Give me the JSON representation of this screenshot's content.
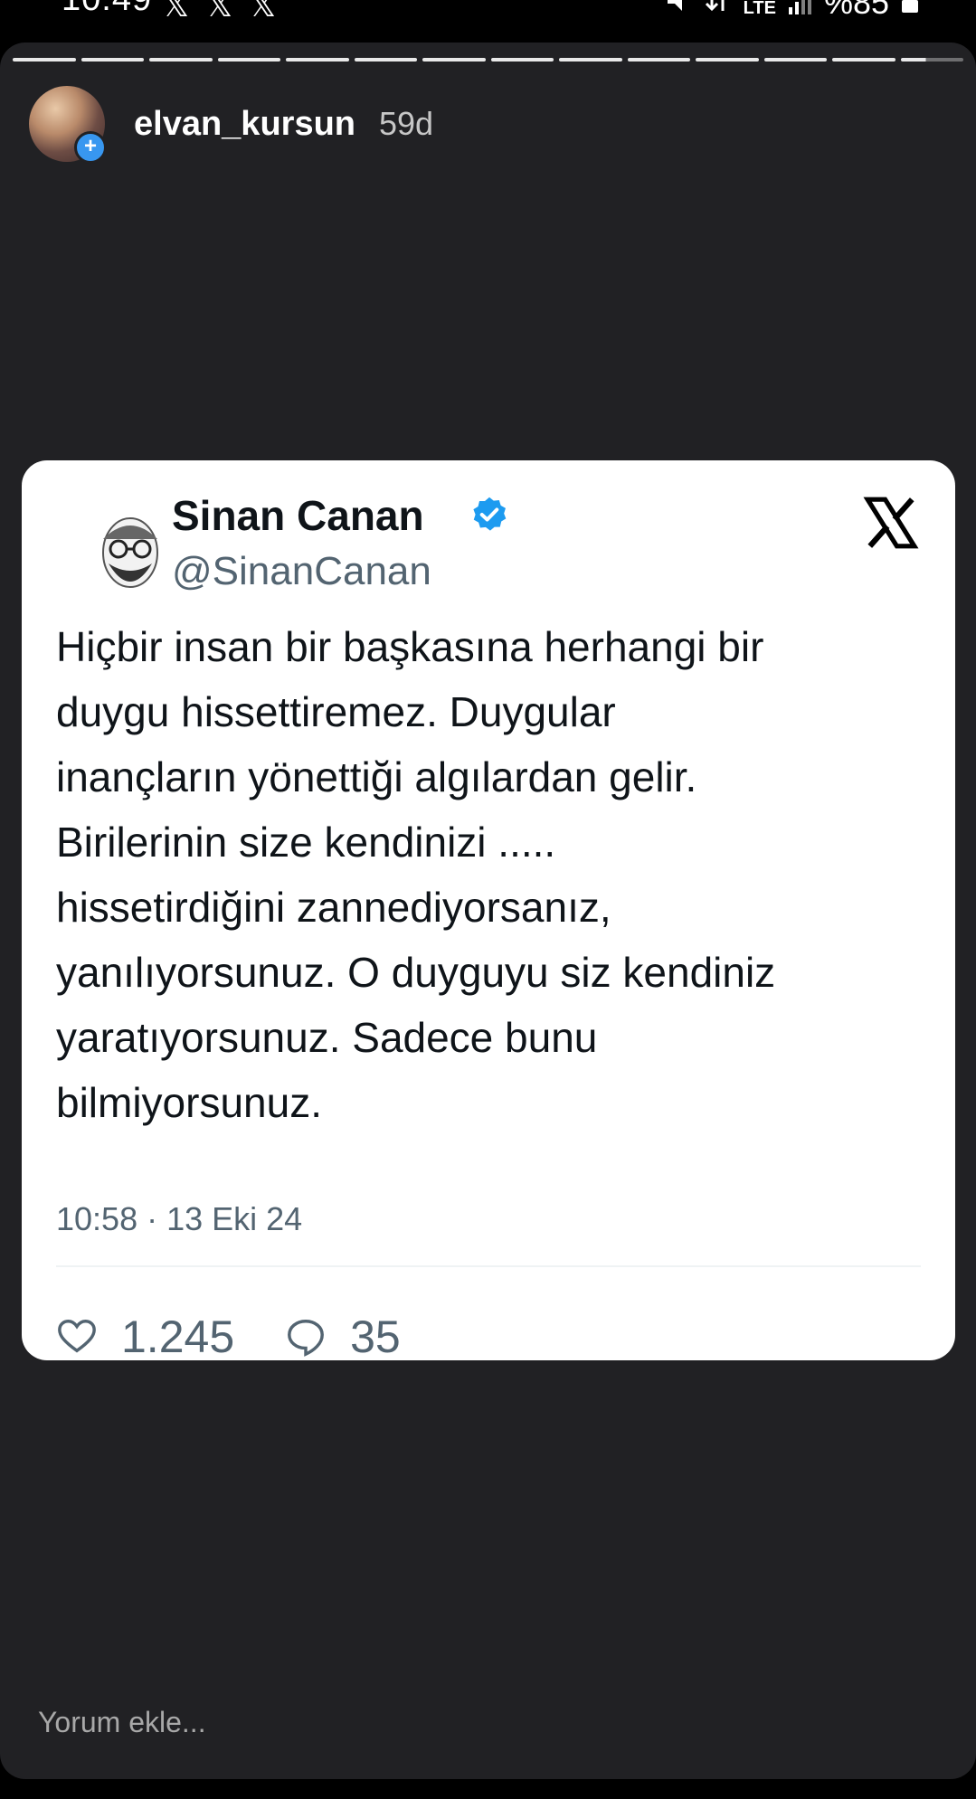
{
  "status_bar": {
    "time": "10:49",
    "notification_icons": [
      "x-logo-icon",
      "x-logo-icon",
      "x-logo-icon"
    ],
    "network": "LTE",
    "battery": "%85"
  },
  "story": {
    "progress_segments": 14,
    "username": "elvan_kursun",
    "time_ago": "59d"
  },
  "tweet": {
    "author_name": "Sinan Canan",
    "handle": "@SinanCanan",
    "text": "Hiçbir insan bir başkasına herhangi bir\nduygu hissettiremez. Duygular\ninançların yönettiği algılardan gelir.\nBirilerinin size kendinizi .....\nhissetirdiğini zannediyorsanız,\nyanılıyorsunuz. O duyguyu siz kendiniz\nyaratıyorsunuz. Sadece bunu\nbilmiyorsunuz.",
    "timestamp": "10:58 · 13 Eki 24",
    "likes": "1.245",
    "replies": "35"
  },
  "comment_placeholder": "Yorum ekle...",
  "colors": {
    "story_bg": "#212124",
    "card_bg": "#ffffff",
    "verified_blue": "#1d9bf0",
    "secondary_text": "#536471"
  }
}
